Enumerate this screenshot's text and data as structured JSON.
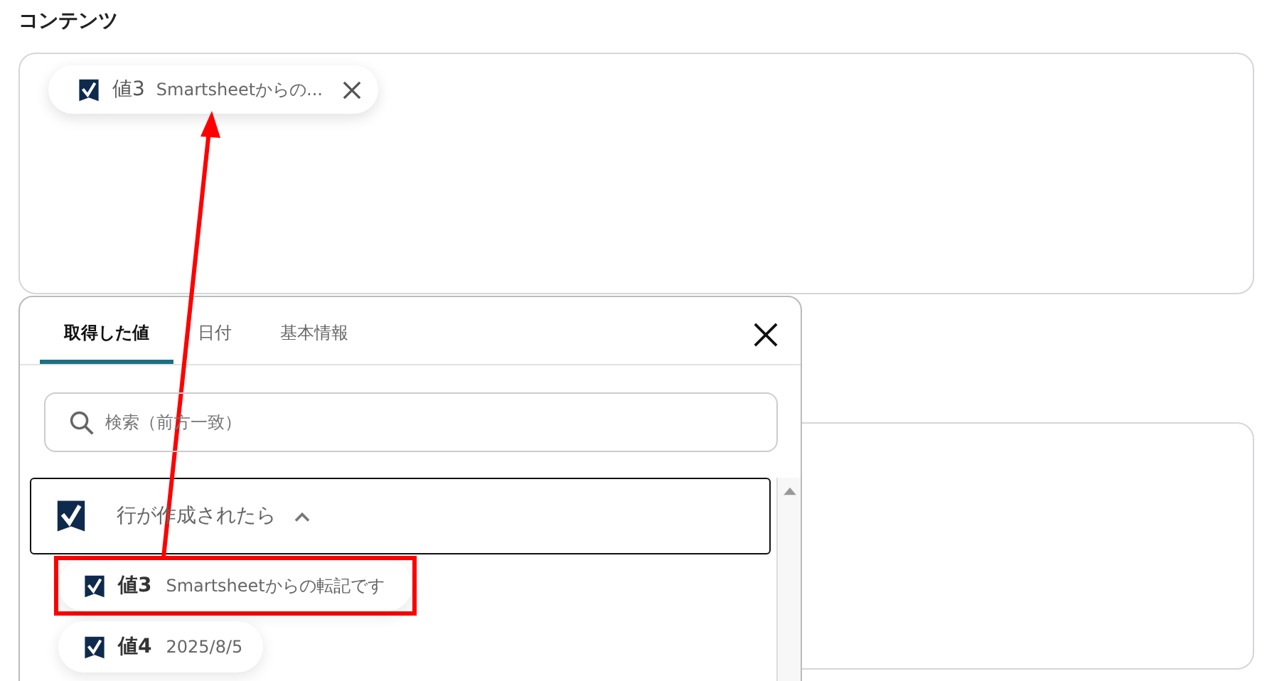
{
  "field": {
    "label": "コンテンツ",
    "chips": [
      {
        "name": "値3",
        "value": "Smartsheetからの..."
      }
    ]
  },
  "popup": {
    "tabs": [
      {
        "label": "取得した値",
        "selected": true
      },
      {
        "label": "日付",
        "selected": false
      },
      {
        "label": "基本情報",
        "selected": false
      }
    ],
    "search": {
      "placeholder": "検索（前方一致）"
    },
    "group": {
      "title": "行が作成されたら",
      "expanded": true
    },
    "items": [
      {
        "name": "値3",
        "value": "Smartsheetからの転記です",
        "highlighted": true
      },
      {
        "name": "値4",
        "value": "2025/8/5",
        "highlighted": false
      }
    ]
  }
}
